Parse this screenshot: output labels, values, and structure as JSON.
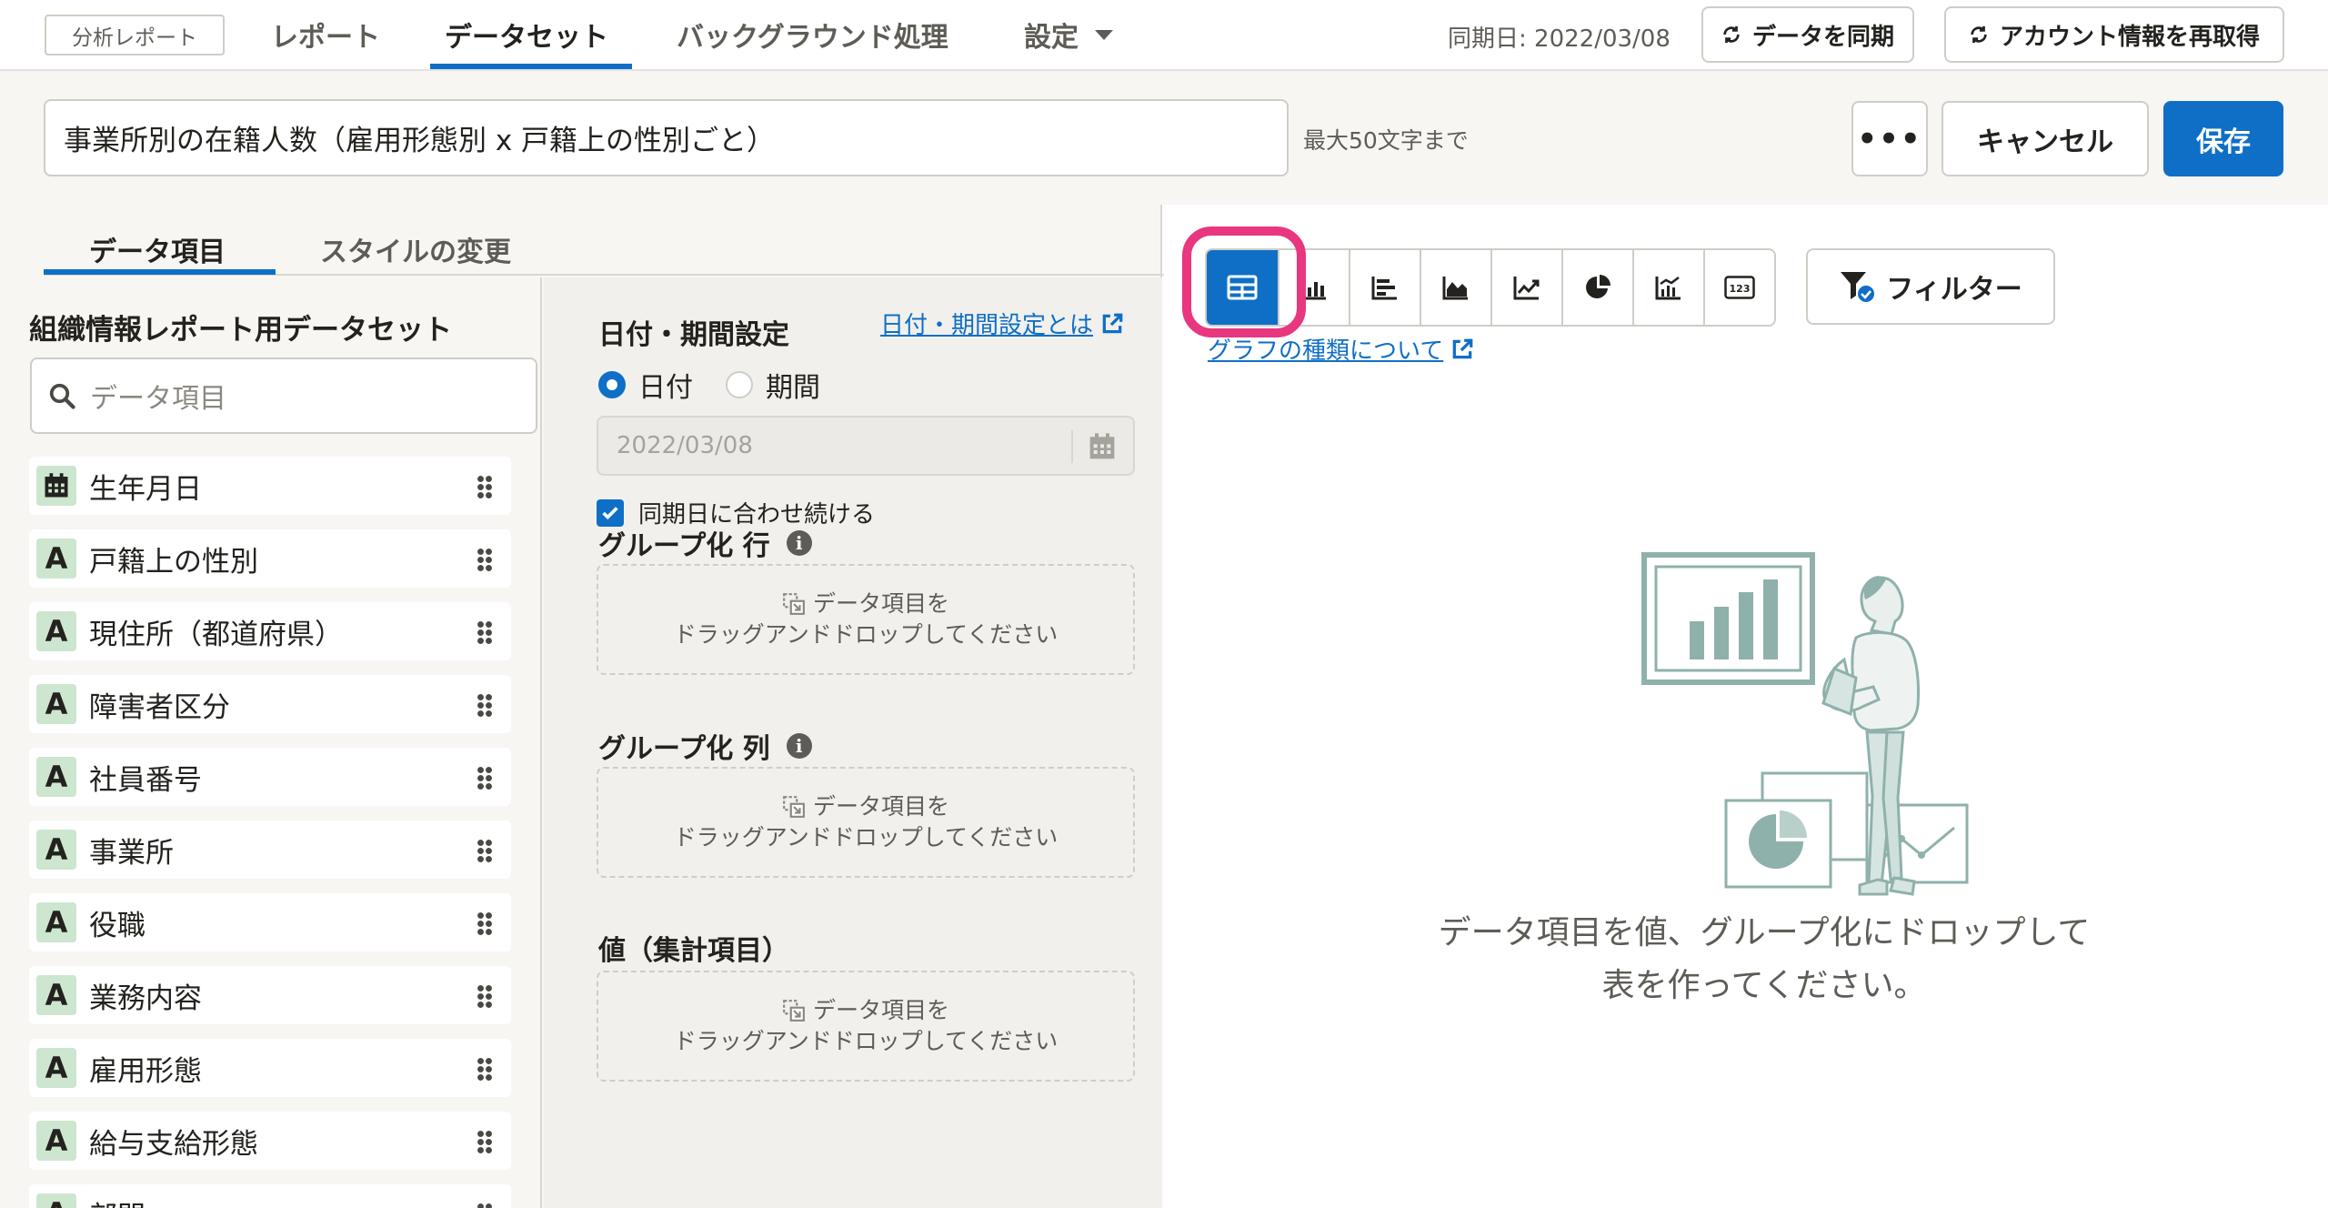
{
  "nav": {
    "app_badge": "分析レポート",
    "tabs": [
      {
        "label": "レポート"
      },
      {
        "label": "データセット"
      },
      {
        "label": "バックグラウンド処理"
      },
      {
        "label": "設定"
      }
    ],
    "sync_date": "同期日: 2022/03/08",
    "sync_button": "データを同期",
    "refetch_button": "アカウント情報を再取得"
  },
  "title_bar": {
    "title_value": "事業所別の在籍人数（雇用形態別 x 戸籍上の性別ごと）",
    "limit_hint": "最大50文字まで",
    "more_label": "•••",
    "cancel_label": "キャンセル",
    "save_label": "保存"
  },
  "left_panel": {
    "tabs": [
      {
        "label": "データ項目"
      },
      {
        "label": "スタイルの変更"
      }
    ],
    "dataset_heading": "組織情報レポート用データセット",
    "search_placeholder": "データ項目",
    "fields": [
      {
        "type": "date",
        "label": "生年月日"
      },
      {
        "type": "A",
        "label": "戸籍上の性別"
      },
      {
        "type": "A",
        "label": "現住所（都道府県）"
      },
      {
        "type": "A",
        "label": "障害者区分"
      },
      {
        "type": "A",
        "label": "社員番号"
      },
      {
        "type": "A",
        "label": "事業所"
      },
      {
        "type": "A",
        "label": "役職"
      },
      {
        "type": "A",
        "label": "業務内容"
      },
      {
        "type": "A",
        "label": "雇用形態"
      },
      {
        "type": "A",
        "label": "給与支給形態"
      },
      {
        "type": "A",
        "label": "部門"
      }
    ]
  },
  "settings": {
    "date_heading": "日付・期間設定",
    "date_help_link": "日付・期間設定とは",
    "radio_date": "日付",
    "radio_period": "期間",
    "selected_mode": "日付",
    "date_value": "2022/03/08",
    "keep_synced_label": "同期日に合わせ続ける",
    "keep_synced_checked": true,
    "group_row_heading": "グループ化 行",
    "group_col_heading": "グループ化 列",
    "values_heading": "値（集計項目）",
    "dropzone_line1": "データ項目を",
    "dropzone_line2": "ドラッグアンドドロップしてください"
  },
  "right_panel": {
    "chart_types": [
      "table-icon",
      "bar-chart-icon",
      "horizontal-bar-icon",
      "area-chart-icon",
      "line-chart-icon",
      "pie-chart-icon",
      "combo-chart-icon",
      "number-icon"
    ],
    "selected_chart_type": "table-icon",
    "filter_label": "フィルター",
    "chart_types_link": "グラフの種類について",
    "empty_line1": "データ項目を値、グループ化にドロップして",
    "empty_line2": "表を作ってください。"
  },
  "colors": {
    "accent": "#0f6fc6",
    "highlight": "#e8377e",
    "badge_green": "#cde6cf",
    "illustration": "#8fb1ab"
  }
}
